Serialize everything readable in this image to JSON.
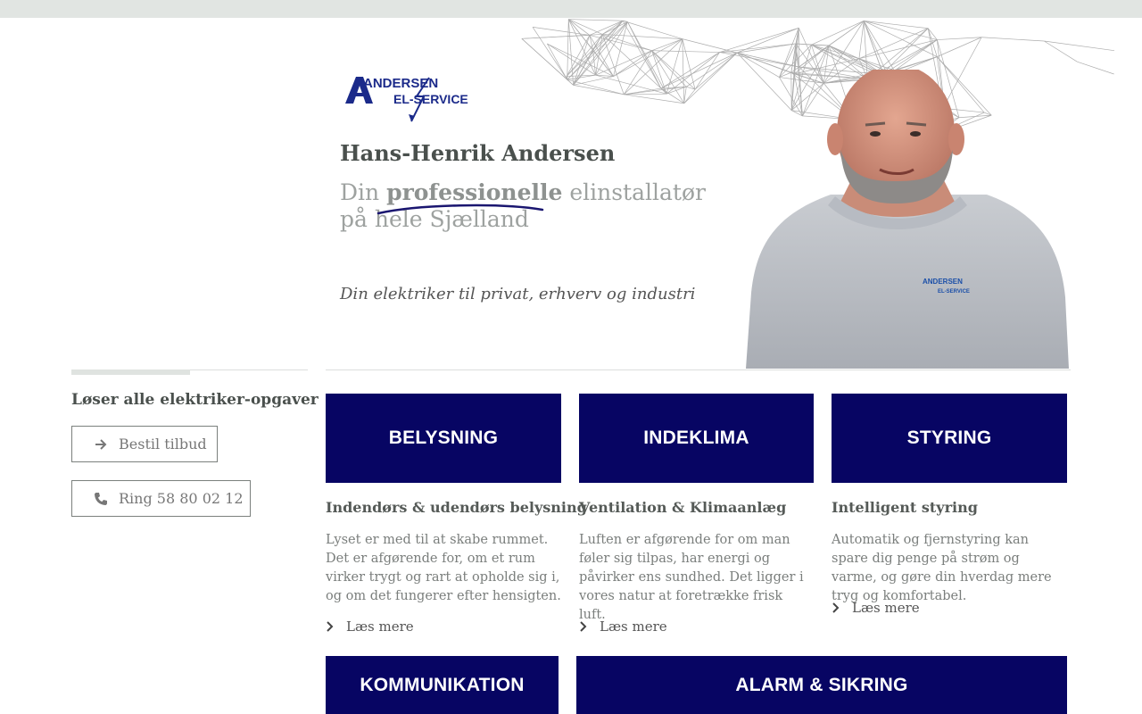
{
  "brand": {
    "logo_text_line1": "ANDERSEN",
    "logo_text_line2": "EL-SERVICE",
    "logo_color": "#1b2a8a"
  },
  "hero": {
    "name": "Hans-Henrik Andersen",
    "tagline_prefix": "Din ",
    "tagline_emphasis": "professionelle",
    "tagline_suffix": " elinstallatør på hele Sjælland",
    "subtitle": "Din elektriker til privat, erhverv og industri",
    "accent_color": "#1a1670"
  },
  "sidebar": {
    "heading": "Løser alle elektriker-opgaver",
    "quote_button": {
      "label": "Bestil tilbud",
      "icon": "arrow-right-icon"
    },
    "call_button": {
      "label": "Ring 58 80 02 12",
      "icon": "phone-icon"
    }
  },
  "services": {
    "tile_color": "#070563",
    "items": [
      {
        "tile": "BELYSNING",
        "title": "Indendørs & udendørs belysning",
        "text": "Lyset er med til at skabe rummet. Det er afgørende for, om et rum virker trygt og rart at opholde sig i, og om det fungerer efter hensigten.",
        "link": "Læs mere"
      },
      {
        "tile": "INDEKLIMA",
        "title": "Ventilation & Klimaanlæg",
        "text": "Luften er afgørende for om man føler sig tilpas, har energi og påvirker ens sundhed. Det ligger i vores natur at foretrække frisk luft.",
        "link": "Læs mere"
      },
      {
        "tile": "STYRING",
        "title": "Intelligent styring",
        "text": "Automatik og fjernstyring kan spare dig penge på strøm og varme, og gøre din hverdag mere tryg og komfortabel.",
        "link": "Læs mere"
      },
      {
        "tile": "KOMMUNIKATION"
      },
      {
        "tile": "ALARM & SIKRING"
      }
    ]
  }
}
